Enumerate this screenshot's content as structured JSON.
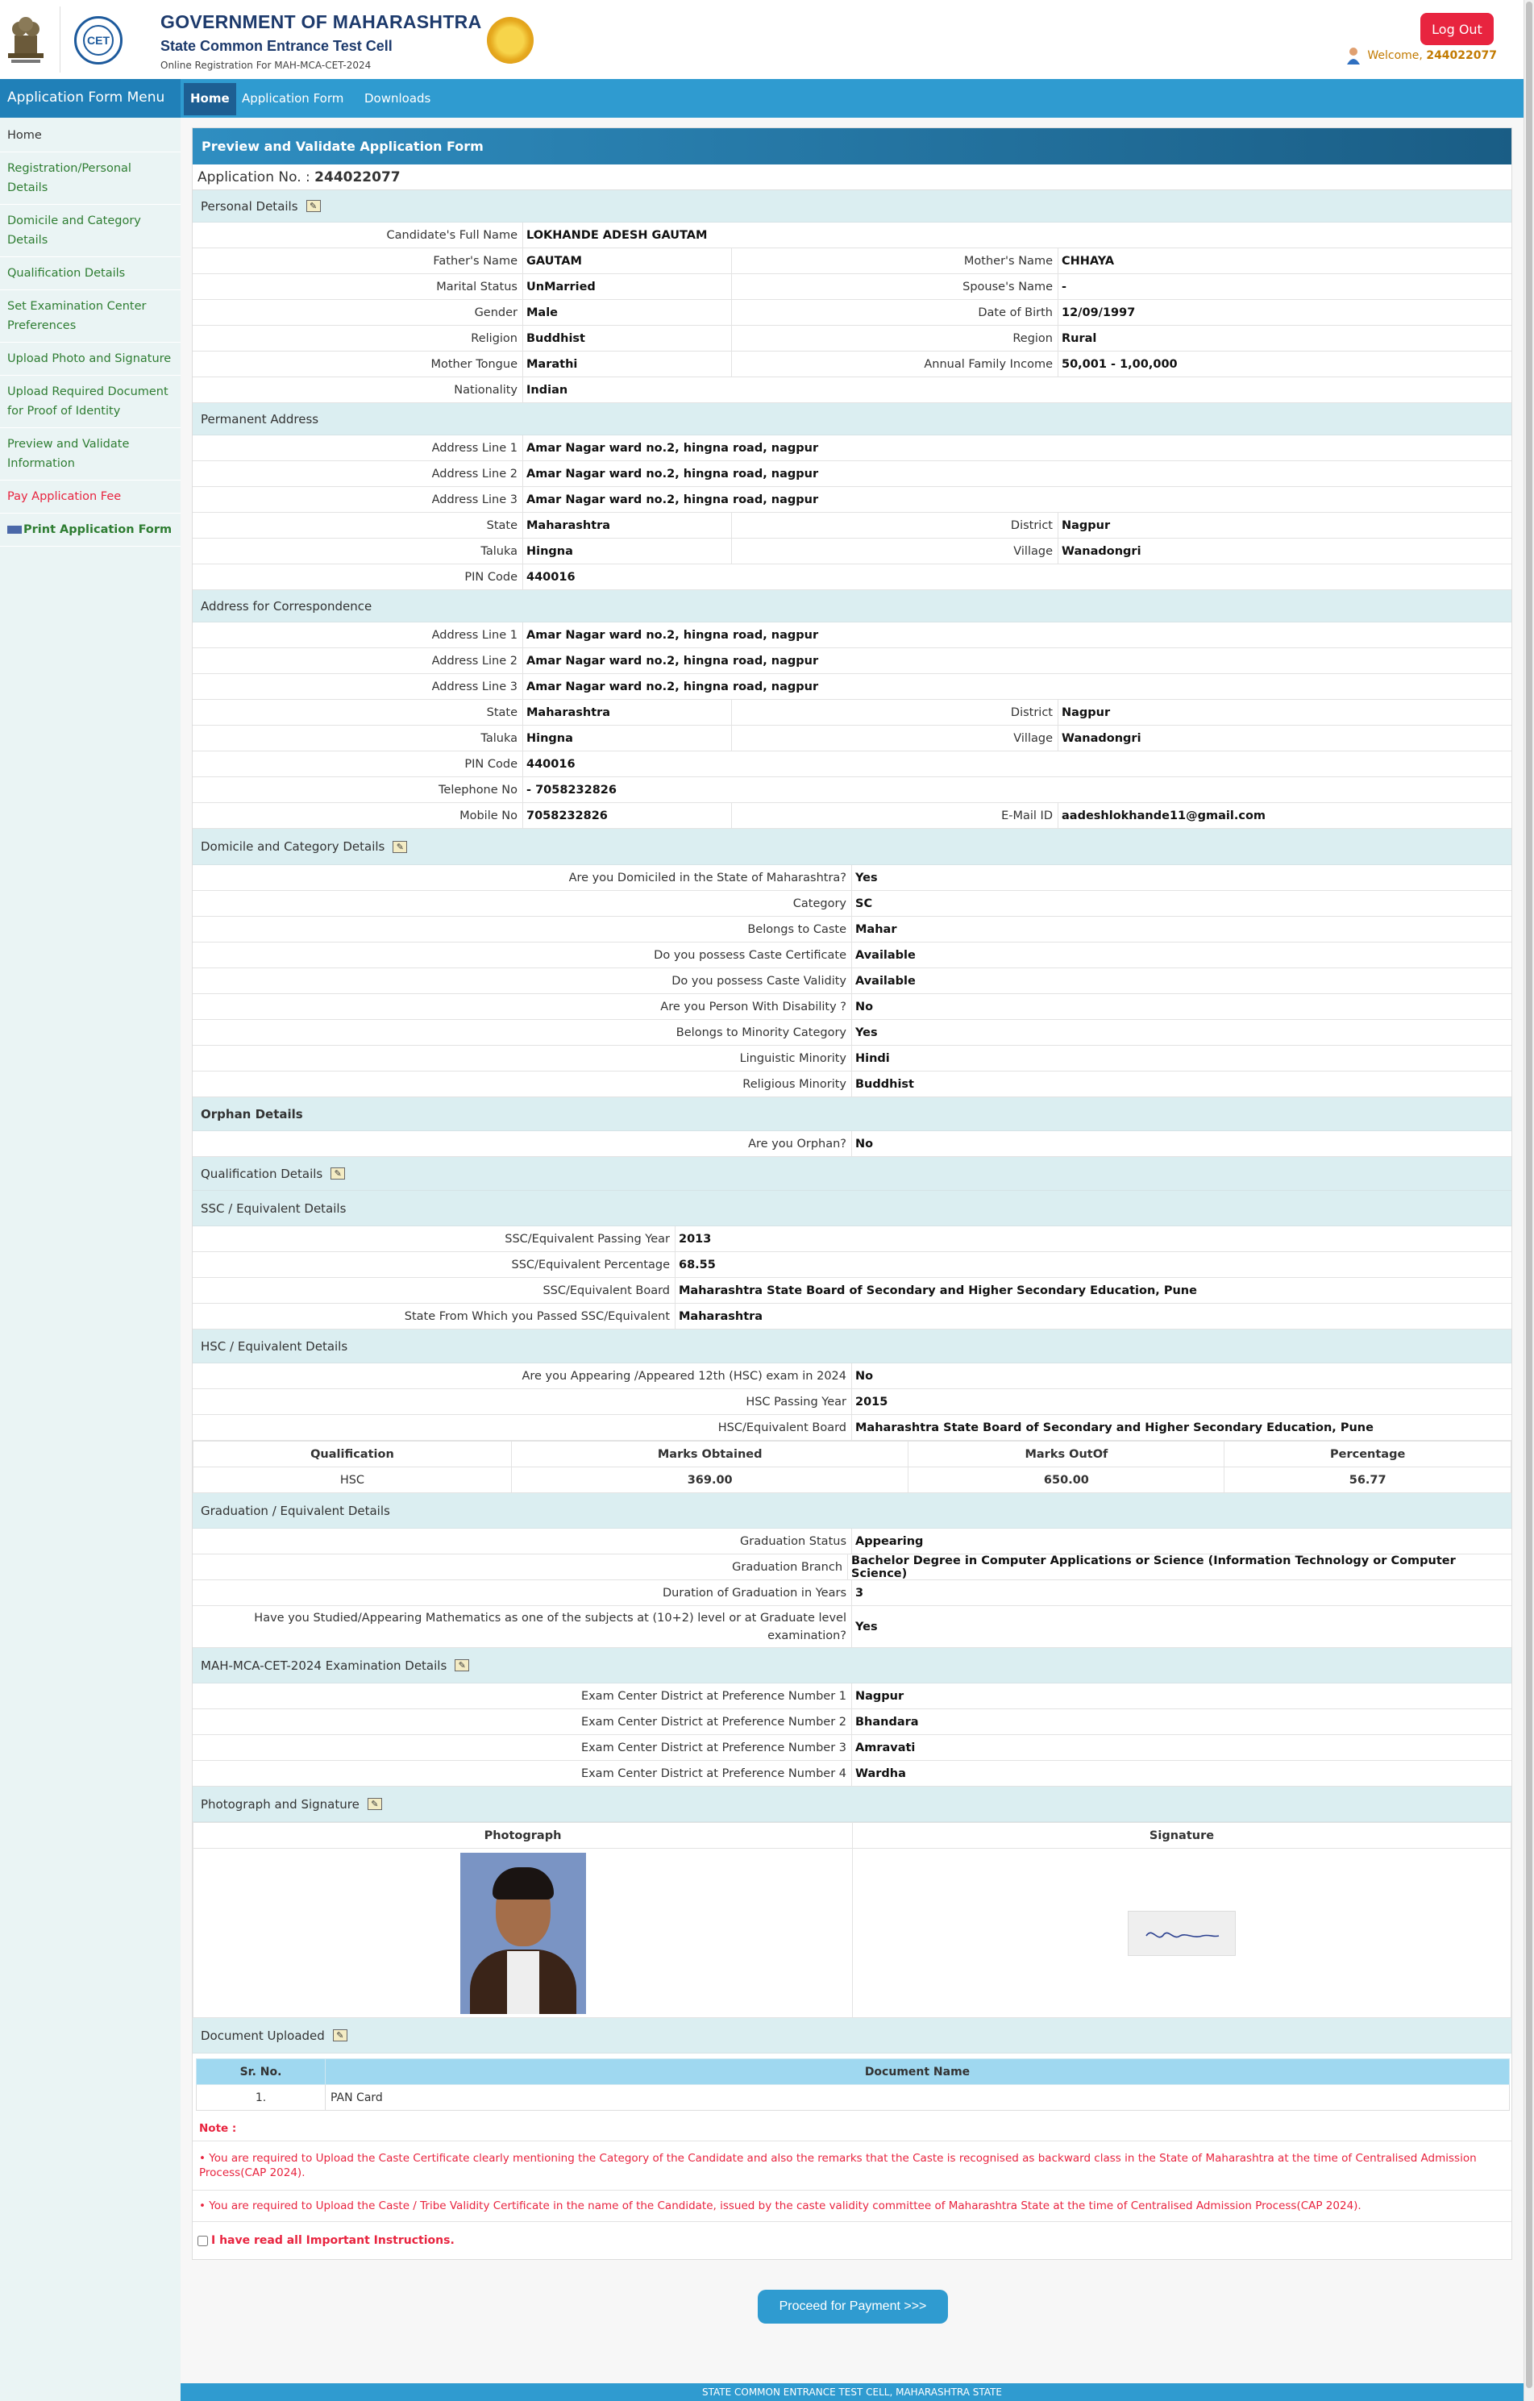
{
  "header": {
    "gov": "GOVERNMENT OF MAHARASHTRA",
    "cell": "State Common Entrance Test Cell",
    "sub": "Online Registration For MAH-MCA-CET-2024",
    "cet_logo": "CET",
    "logout": "Log Out",
    "welcome": "Welcome,",
    "user": "244022077"
  },
  "nav": {
    "menu_title": "Application Form Menu",
    "home": "Home",
    "app_form": "Application Form",
    "downloads": "Downloads"
  },
  "sidebar": [
    "Home",
    "Registration/Personal Details",
    "Domicile and Category Details",
    "Qualification Details",
    "Set Examination Center Preferences",
    "Upload Photo and Signature",
    "Upload Required Document for Proof of Identity",
    "Preview and Validate Information",
    "Pay Application Fee",
    "Print Application Form"
  ],
  "panel": {
    "title": "Preview and Validate Application Form",
    "appno_label": "Application No. :",
    "appno": "244022077"
  },
  "sections": {
    "personal": "Personal Details",
    "perm": "Permanent Address",
    "corr": "Address for Correspondence",
    "domicile": "Domicile and Category Details",
    "orphan": "Orphan Details",
    "qual": "Qualification Details",
    "ssc": "SSC / Equivalent Details",
    "hsc": "HSC / Equivalent Details",
    "grad": "Graduation / Equivalent Details",
    "exam": "MAH-MCA-CET-2024 Examination Details",
    "photo": "Photograph and Signature",
    "docs": "Document Uploaded"
  },
  "personal": {
    "full_name_l": "Candidate's Full Name",
    "full_name": "LOKHANDE ADESH GAUTAM",
    "father_l": "Father's Name",
    "father": "GAUTAM",
    "mother_l": "Mother's Name",
    "mother": "CHHAYA",
    "marital_l": "Marital Status",
    "marital": "UnMarried",
    "spouse_l": "Spouse's Name",
    "spouse": "-",
    "gender_l": "Gender",
    "gender": "Male",
    "dob_l": "Date of Birth",
    "dob": "12/09/1997",
    "religion_l": "Religion",
    "religion": "Buddhist",
    "region_l": "Region",
    "region": "Rural",
    "tongue_l": "Mother Tongue",
    "tongue": "Marathi",
    "income_l": "Annual Family Income",
    "income": "50,001 - 1,00,000",
    "nation_l": "Nationality",
    "nation": "Indian"
  },
  "perm": {
    "a1_l": "Address Line 1",
    "a1": "Amar Nagar ward no.2, hingna road, nagpur",
    "a2_l": "Address Line 2",
    "a2": "Amar Nagar ward no.2, hingna road, nagpur",
    "a3_l": "Address Line 3",
    "a3": "Amar Nagar ward no.2, hingna road, nagpur",
    "state_l": "State",
    "state": "Maharashtra",
    "district_l": "District",
    "district": "Nagpur",
    "taluka_l": "Taluka",
    "taluka": "Hingna",
    "village_l": "Village",
    "village": "Wanadongri",
    "pin_l": "PIN Code",
    "pin": "440016"
  },
  "corr": {
    "a1_l": "Address Line 1",
    "a1": "Amar Nagar ward no.2, hingna road, nagpur",
    "a2_l": "Address Line 2",
    "a2": "Amar Nagar ward no.2, hingna road, nagpur",
    "a3_l": "Address Line 3",
    "a3": "Amar Nagar ward no.2, hingna road, nagpur",
    "state_l": "State",
    "state": "Maharashtra",
    "district_l": "District",
    "district": "Nagpur",
    "taluka_l": "Taluka",
    "taluka": "Hingna",
    "village_l": "Village",
    "village": "Wanadongri",
    "pin_l": "PIN Code",
    "pin": "440016",
    "tel_l": "Telephone No",
    "tel": "- 7058232826",
    "mobile_l": "Mobile No",
    "mobile": "7058232826",
    "email_l": "E-Mail ID",
    "email": "aadeshlokhande11@gmail.com"
  },
  "domicile": [
    [
      "Are you Domiciled in the State of Maharashtra?",
      "Yes"
    ],
    [
      "Category",
      "SC"
    ],
    [
      "Belongs to Caste",
      "Mahar"
    ],
    [
      "Do you possess Caste Certificate",
      "Available"
    ],
    [
      "Do you possess Caste Validity",
      "Available"
    ],
    [
      "Are you Person With Disability ?",
      "No"
    ],
    [
      "Belongs to Minority Category",
      "Yes"
    ],
    [
      "Linguistic Minority",
      "Hindi"
    ],
    [
      "Religious Minority",
      "Buddhist"
    ]
  ],
  "orphan": {
    "q": "Are you Orphan?",
    "a": "No"
  },
  "ssc": [
    [
      "SSC/Equivalent Passing Year",
      "2013"
    ],
    [
      "SSC/Equivalent Percentage",
      "68.55"
    ],
    [
      "SSC/Equivalent Board",
      "Maharashtra State Board of Secondary and Higher Secondary Education, Pune"
    ],
    [
      "State From Which you Passed SSC/Equivalent",
      "Maharashtra"
    ]
  ],
  "hsc": [
    [
      "Are you Appearing /Appeared 12th (HSC) exam in 2024",
      "No"
    ],
    [
      "HSC Passing Year",
      "2015"
    ],
    [
      "HSC/Equivalent Board",
      "Maharashtra State Board of Secondary and Higher Secondary Education, Pune"
    ]
  ],
  "hsc_table": {
    "headers": [
      "Qualification",
      "Marks Obtained",
      "Marks OutOf",
      "Percentage"
    ],
    "row": [
      "HSC",
      "369.00",
      "650.00",
      "56.77"
    ]
  },
  "grad": [
    [
      "Graduation Status",
      "Appearing"
    ],
    [
      "Graduation Branch",
      "Bachelor Degree in Computer Applications or Science (Information Technology or Computer Science)"
    ],
    [
      "Duration of Graduation in Years",
      "3"
    ],
    [
      "Have you Studied/Appearing Mathematics as one of the subjects at (10+2) level or at Graduate level examination?",
      "Yes"
    ]
  ],
  "exam": [
    [
      "Exam Center District at Preference Number 1",
      "Nagpur"
    ],
    [
      "Exam Center District at Preference Number 2",
      "Bhandara"
    ],
    [
      "Exam Center District at Preference Number 3",
      "Amravati"
    ],
    [
      "Exam Center District at Preference Number 4",
      "Wardha"
    ]
  ],
  "photo": {
    "photo_h": "Photograph",
    "sig_h": "Signature"
  },
  "docs": {
    "h_sr": "Sr. No.",
    "h_name": "Document Name",
    "sr": "1.",
    "name": "PAN Card"
  },
  "notes": {
    "title": "Note :",
    "n1": "• You are required to Upload the Caste Certificate clearly mentioning the Category of the Candidate and also the remarks that the Caste is recognised as backward class in the State of Maharashtra at the time of Centralised Admission Process(CAP 2024).",
    "n2": "• You are required to Upload the Caste / Tribe Validity Certificate in the name of the Candidate, issued by the caste validity committee of Maharashtra State at the time of Centralised Admission Process(CAP 2024).",
    "check": "I have read all Important Instructions."
  },
  "proceed": "Proceed for Payment >>>",
  "footer": "STATE COMMON ENTRANCE TEST CELL, MAHARASHTRA STATE"
}
